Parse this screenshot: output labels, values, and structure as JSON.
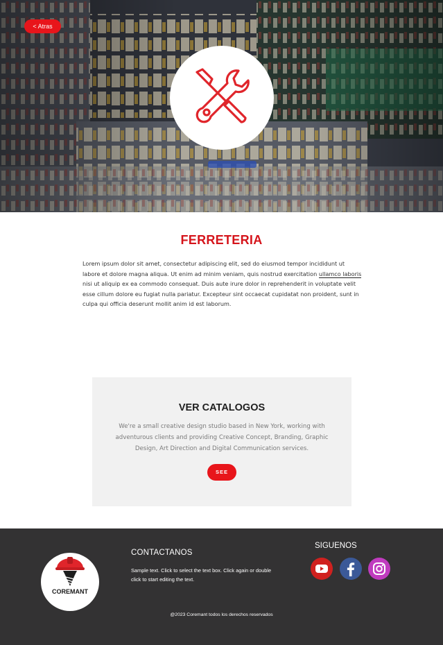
{
  "hero": {
    "back_label": "< Atras"
  },
  "about": {
    "title": "FERRETERIA",
    "text_before_link": "Lorem ipsum dolor sit amet, consectetur adipiscing elit, sed do eiusmod tempor incididunt ut labore et dolore magna aliqua. Ut enim ad minim veniam, quis nostrud exercitation ",
    "link_text": "ullamco laboris",
    "text_after_link": " nisi ut aliquip ex ea commodo consequat. Duis aute irure dolor in reprehenderit in voluptate velit esse cillum dolore eu fugiat nulla pariatur. Excepteur sint occaecat cupidatat non proident, sunt in culpa qui officia deserunt mollit anim id est laborum."
  },
  "catalog": {
    "title": "VER CATALOGOS",
    "text": "We're a small creative design studio based in New York, working with adventurous clients and providing Creative Concept, Branding, Graphic Design, Art Direction and Digital Communication services.",
    "button_label": "SEE"
  },
  "footer": {
    "logo_text": "COREMANT",
    "contact_title": "CONTACTANOS",
    "contact_text": "Sample text. Click to select the text box. Click again or double click to start editing the text.",
    "follow_title": "SIGUENOS",
    "social": [
      {
        "name": "youtube",
        "icon": "youtube-icon",
        "color": "#d0211f"
      },
      {
        "name": "facebook",
        "icon": "facebook-icon",
        "color": "#3b5998"
      },
      {
        "name": "instagram",
        "icon": "instagram-icon",
        "color": "#c03bbf"
      }
    ],
    "copyright": "@2023 Coremant todos los derechos reservados"
  },
  "colors": {
    "accent": "#e8151b",
    "title_red": "#d5141b",
    "footer_bg": "#333233",
    "catalog_bg": "#f1f1f1"
  }
}
